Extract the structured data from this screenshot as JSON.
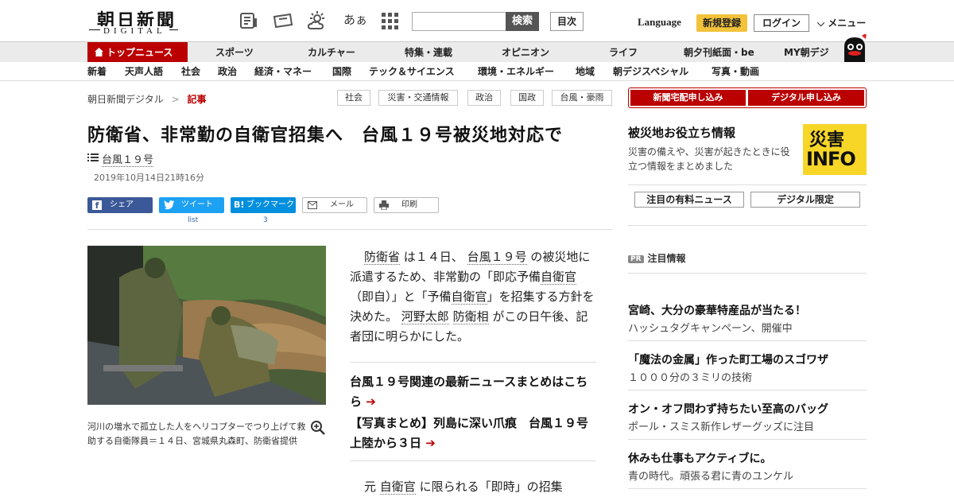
{
  "header": {
    "logo_jp": "朝日新聞",
    "logo_en": "DIGITAL",
    "font_size_label": "あぁ",
    "search_button": "検索",
    "toc_button": "目次",
    "language": "Language",
    "register": "新規登録",
    "login": "ログイン",
    "menu": "メニュー"
  },
  "nav_primary": [
    "トップニュース",
    "スポーツ",
    "カルチャー",
    "特集・連載",
    "オピニオン",
    "ライフ",
    "朝夕刊紙面・be",
    "MY朝デジ"
  ],
  "nav_secondary": [
    "新着",
    "天声人語",
    "社会",
    "政治",
    "経済・マネー",
    "国際",
    "テック＆サイエンス",
    "環境・エネルギー",
    "地域",
    "朝デジスペシャル",
    "写真・動画"
  ],
  "breadcrumb": {
    "home": "朝日新聞デジタル",
    "sep": ">",
    "current": "記事"
  },
  "tags": [
    "社会",
    "災害・交通情報",
    "政治",
    "国政",
    "台風・豪雨"
  ],
  "subscribe": {
    "paper": "新聞宅配申し込み",
    "digital": "デジタル申し込み"
  },
  "article": {
    "title": "防衛省、非常勤の自衛官招集へ　台風１９号被災地対応で",
    "topic": "台風１９号",
    "date": "2019年10月14日21時16分",
    "share": {
      "facebook": "シェア",
      "twitter": "ツイート",
      "twitter_count": "list",
      "hatena": "ブックマーク",
      "hatena_count": "3",
      "mail": "メール",
      "print": "印刷"
    },
    "caption": "河川の増水で孤立した人をヘリコプターでつり上げて救助する自衛隊員＝１４日、宮城県丸森町、防衛省提供",
    "body": {
      "p1_a": "防衛省",
      "p1_b": "は１４日、",
      "p1_c": "台風１９号",
      "p1_d": "の被災地に派遣するため、非常勤の「即応予備",
      "p1_e": "自衛官",
      "p1_f": "（即自）」と「予備",
      "p1_g": "自衛官",
      "p1_h": "」を招集する方針を決めた。",
      "p1_i": "河野太郎",
      "p1_j": "防衛相",
      "p1_k": "がこの日午後、記者団に明らかにした。",
      "p2_a": "元",
      "p2_b": "自衛官",
      "p2_c": "に限られる「即時」の招集"
    },
    "related": [
      "台風１９号関連の最新ニュースまとめはこちら",
      "【写真まとめ】列島に深い爪痕　台風１９号上陸から３日"
    ]
  },
  "sidebar": {
    "disaster_title": "被災地お役立ち情報",
    "disaster_desc": "災害の備えや、災害が起きたときに役立つ情報をまとめました",
    "info_badge_top": "災害",
    "info_badge_bottom": "INFO",
    "tabs": [
      "注目の有料ニュース",
      "デジタル限定"
    ],
    "pr_badge": "PR",
    "pr_title": "注目情報",
    "ads": [
      {
        "title": "宮崎、大分の豪華特産品が当たる！",
        "sub": "ハッシュタグキャンペーン、開催中"
      },
      {
        "title": "「魔法の金属」作った町工場のスゴワザ",
        "sub": "１０００分の３ミリの技術"
      },
      {
        "title": "オン・オフ問わず持ちたい至高のバッグ",
        "sub": "ポール・スミス新作レザーグッズに注目"
      },
      {
        "title": "休みも仕事もアクティブに。",
        "sub": "青の時代。頑張る君に青のユンケル"
      }
    ]
  },
  "colors": {
    "brand_red": "#bb0000",
    "register_yellow": "#f3c23b",
    "facebook": "#3b5998",
    "twitter": "#1da1f2",
    "hatena": "#008fde"
  }
}
